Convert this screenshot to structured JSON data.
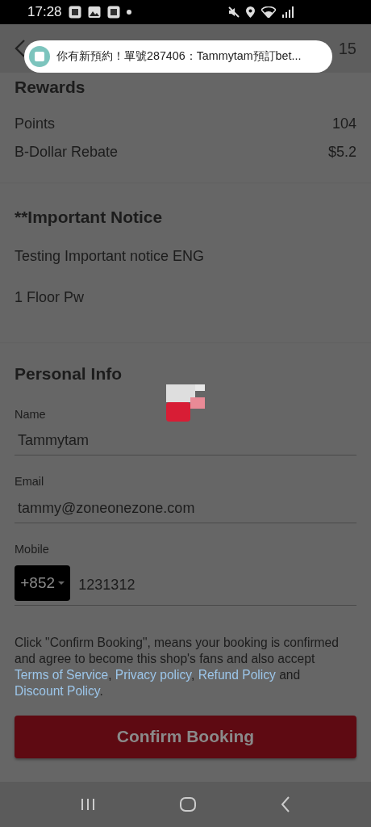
{
  "status_bar": {
    "time": "17:28"
  },
  "header": {
    "title": "15"
  },
  "notification": {
    "text": "你有新預約！單號287406：Tammytam預訂bet..."
  },
  "rewards": {
    "title": "Rewards",
    "rows": [
      {
        "label": "Points",
        "value": "104"
      },
      {
        "label": "B-Dollar Rebate",
        "value": "$5.2"
      }
    ]
  },
  "notice": {
    "title": "**Important Notice",
    "lines": [
      "Testing Important notice ENG",
      "1 Floor Pw"
    ]
  },
  "personal_info": {
    "title": "Personal Info",
    "fields": [
      {
        "kind": "text",
        "label": "Name",
        "value": "Tammytam"
      },
      {
        "kind": "text",
        "label": "Email",
        "value": "tammy@zoneonezone.com"
      },
      {
        "kind": "phone",
        "label": "Mobile",
        "country_code": "+852",
        "value": "1231312"
      }
    ]
  },
  "terms": [
    {
      "kind": "text",
      "text": "Click \"Confirm Booking\", means your booking is confirmed and agree to become this shop's fans and also accept "
    },
    {
      "kind": "link",
      "text": "Terms of Service"
    },
    {
      "kind": "text",
      "text": ", "
    },
    {
      "kind": "link",
      "text": "Privacy policy"
    },
    {
      "kind": "text",
      "text": ", "
    },
    {
      "kind": "link",
      "text": "Refund Policy"
    },
    {
      "kind": "text",
      "text": " and "
    },
    {
      "kind": "link",
      "text": "Discount Policy"
    },
    {
      "kind": "text",
      "text": "."
    }
  ],
  "confirm_button": {
    "label": "Confirm Booking"
  },
  "loading": true
}
